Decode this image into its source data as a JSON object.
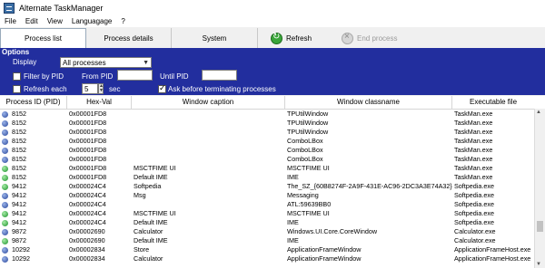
{
  "window": {
    "title": "Alternate TaskManager"
  },
  "menu": [
    "File",
    "Edit",
    "View",
    "Languagage",
    "?"
  ],
  "tabs": [
    "Process list",
    "Process details",
    "System"
  ],
  "toolbar": {
    "refresh_label": "Refresh",
    "end_label": "End process"
  },
  "options": {
    "title": "Options",
    "display_label": "Display",
    "display_value": "All processes",
    "filter_label": "Filter by PID",
    "from_label": "From PID",
    "until_label": "Until PID",
    "from_value": "",
    "until_value": "",
    "refresh_label": "Refresh each",
    "refresh_value": "5",
    "sec_label": "sec",
    "ask_label": "Ask before terminating processes",
    "filter_checked": false,
    "refresh_checked": false,
    "ask_checked": true
  },
  "table": {
    "columns": [
      "Process ID (PID)",
      "Hex-Val",
      "Window caption",
      "Window classname",
      "Executable file"
    ],
    "rows": [
      {
        "pid": "8152",
        "hex": "0x00001FD8",
        "caption": "",
        "classname": "TPUtilWindow",
        "exe": "TaskMan.exe",
        "icon": "blue"
      },
      {
        "pid": "8152",
        "hex": "0x00001FD8",
        "caption": "",
        "classname": "TPUtilWindow",
        "exe": "TaskMan.exe",
        "icon": "blue"
      },
      {
        "pid": "8152",
        "hex": "0x00001FD8",
        "caption": "",
        "classname": "TPUtilWindow",
        "exe": "TaskMan.exe",
        "icon": "blue"
      },
      {
        "pid": "8152",
        "hex": "0x00001FD8",
        "caption": "",
        "classname": "ComboLBox",
        "exe": "TaskMan.exe",
        "icon": "blue"
      },
      {
        "pid": "8152",
        "hex": "0x00001FD8",
        "caption": "",
        "classname": "ComboLBox",
        "exe": "TaskMan.exe",
        "icon": "blue"
      },
      {
        "pid": "8152",
        "hex": "0x00001FD8",
        "caption": "",
        "classname": "ComboLBox",
        "exe": "TaskMan.exe",
        "icon": "blue"
      },
      {
        "pid": "8152",
        "hex": "0x00001FD8",
        "caption": "MSCTFIME UI",
        "classname": "MSCTFIME UI",
        "exe": "TaskMan.exe",
        "icon": "green"
      },
      {
        "pid": "8152",
        "hex": "0x00001FD8",
        "caption": "Default IME",
        "classname": "IME",
        "exe": "TaskMan.exe",
        "icon": "green"
      },
      {
        "pid": "9412",
        "hex": "0x000024C4",
        "caption": "Softpedia",
        "classname": "The_SZ_{60B8274F-2A9F-431E-AC96-2DC3A3E74A32}",
        "exe": "Softpedia.exe",
        "icon": "green"
      },
      {
        "pid": "9412",
        "hex": "0x000024C4",
        "caption": "Msg",
        "classname": "Messaging",
        "exe": "Softpedia.exe",
        "icon": "blue"
      },
      {
        "pid": "9412",
        "hex": "0x000024C4",
        "caption": "",
        "classname": "ATL:59639BB0",
        "exe": "Softpedia.exe",
        "icon": "blue"
      },
      {
        "pid": "9412",
        "hex": "0x000024C4",
        "caption": "MSCTFIME UI",
        "classname": "MSCTFIME UI",
        "exe": "Softpedia.exe",
        "icon": "green"
      },
      {
        "pid": "9412",
        "hex": "0x000024C4",
        "caption": "Default IME",
        "classname": "IME",
        "exe": "Softpedia.exe",
        "icon": "green"
      },
      {
        "pid": "9872",
        "hex": "0x00002690",
        "caption": "Calculator",
        "classname": "Windows.UI.Core.CoreWindow",
        "exe": "Calculator.exe",
        "icon": "blue"
      },
      {
        "pid": "9872",
        "hex": "0x00002690",
        "caption": "Default IME",
        "classname": "IME",
        "exe": "Calculator.exe",
        "icon": "green"
      },
      {
        "pid": "10292",
        "hex": "0x00002834",
        "caption": "Store",
        "classname": "ApplicationFrameWindow",
        "exe": "ApplicationFrameHost.exe",
        "icon": "blue"
      },
      {
        "pid": "10292",
        "hex": "0x00002834",
        "caption": "Calculator",
        "classname": "ApplicationFrameWindow",
        "exe": "ApplicationFrameHost.exe",
        "icon": "blue"
      }
    ]
  }
}
